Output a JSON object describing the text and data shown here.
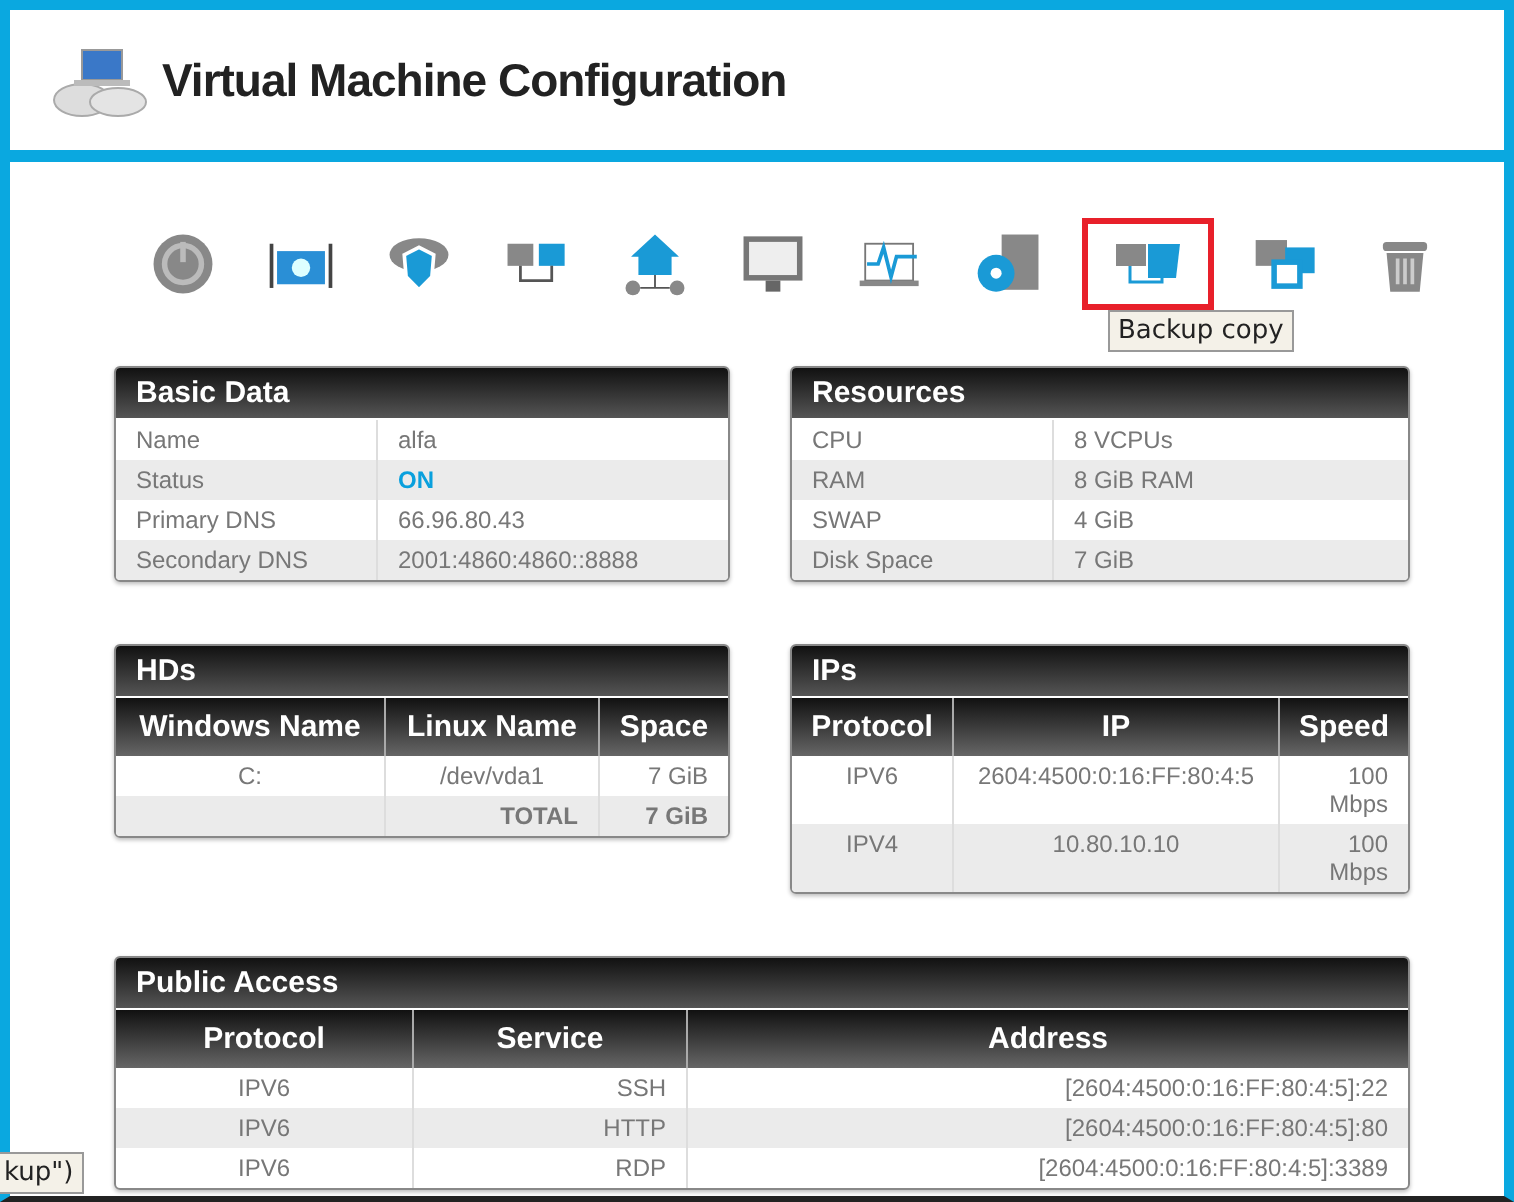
{
  "header": {
    "title": "Virtual Machine Configuration"
  },
  "toolbar": [
    {
      "kind": "power",
      "selected": false
    },
    {
      "kind": "toolbox",
      "selected": false
    },
    {
      "kind": "shield",
      "selected": false
    },
    {
      "kind": "servers",
      "selected": false
    },
    {
      "kind": "home",
      "selected": false
    },
    {
      "kind": "monitor",
      "selected": false
    },
    {
      "kind": "pulse",
      "selected": false
    },
    {
      "kind": "disc",
      "selected": false
    },
    {
      "kind": "backup",
      "selected": true
    },
    {
      "kind": "clone",
      "selected": false
    },
    {
      "kind": "trash",
      "selected": false
    }
  ],
  "tooltip": {
    "text": "Backup copy"
  },
  "basic_data": {
    "title": "Basic Data",
    "rows": [
      {
        "label": "Name",
        "value": "alfa"
      },
      {
        "label": "Status",
        "value": "ON",
        "kind": "status"
      },
      {
        "label": "Primary DNS",
        "value": "66.96.80.43"
      },
      {
        "label": "Secondary DNS",
        "value": "2001:4860:4860::8888"
      }
    ]
  },
  "resources": {
    "title": "Resources",
    "rows": [
      {
        "label": "CPU",
        "value": "8 VCPUs"
      },
      {
        "label": "RAM",
        "value": "8 GiB RAM"
      },
      {
        "label": "SWAP",
        "value": "4 GiB"
      },
      {
        "label": "Disk Space",
        "value": "7 GiB"
      }
    ]
  },
  "hds": {
    "title": "HDs",
    "columns": [
      "Windows Name",
      "Linux Name",
      "Space"
    ],
    "rows": [
      [
        "C:",
        "/dev/vda1",
        "7 GiB"
      ]
    ],
    "total": {
      "label": "TOTAL",
      "value": "7 GiB"
    }
  },
  "ips": {
    "title": "IPs",
    "columns": [
      "Protocol",
      "IP",
      "Speed"
    ],
    "rows": [
      [
        "IPV6",
        "2604:4500:0:16:FF:80:4:5",
        "100 Mbps"
      ],
      [
        "IPV4",
        "10.80.10.10",
        "100 Mbps"
      ]
    ]
  },
  "public_access": {
    "title": "Public Access",
    "columns": [
      "Protocol",
      "Service",
      "Address"
    ],
    "rows": [
      [
        "IPV6",
        "SSH",
        "[2604:4500:0:16:FF:80:4:5]:22"
      ],
      [
        "IPV6",
        "HTTP",
        "[2604:4500:0:16:FF:80:4:5]:80"
      ],
      [
        "IPV6",
        "RDP",
        "[2604:4500:0:16:FF:80:4:5]:3389"
      ]
    ]
  },
  "corner_tooltip": {
    "text": "kup\")"
  }
}
